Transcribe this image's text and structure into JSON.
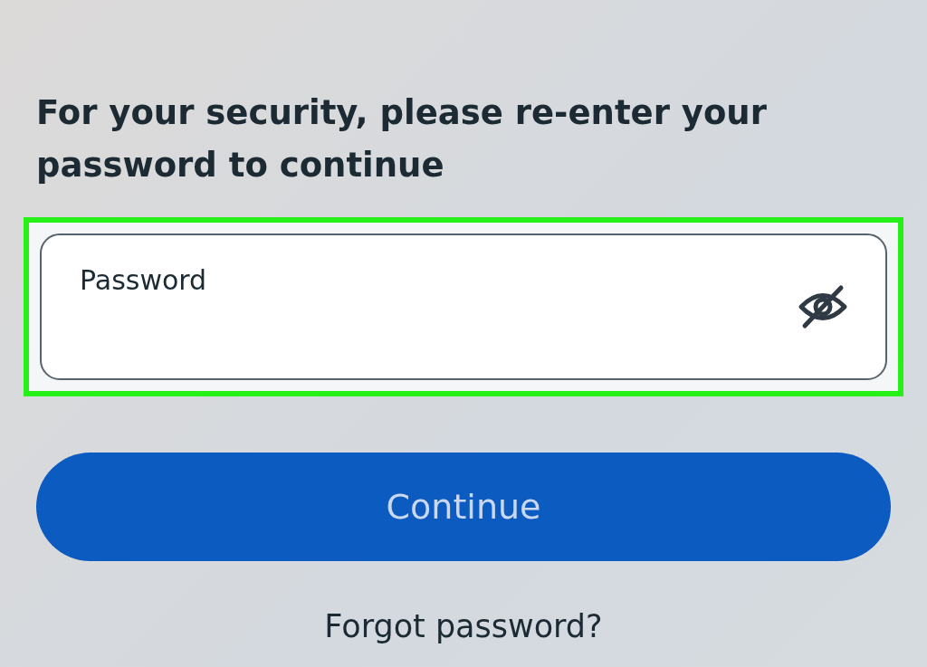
{
  "prompt": "For your security, please re-enter your password to continue",
  "password_field": {
    "placeholder": "Password",
    "highlighted": true,
    "password_visible": false
  },
  "continue_button": {
    "label": "Continue"
  },
  "forgot_link": {
    "label": "Forgot password?"
  }
}
